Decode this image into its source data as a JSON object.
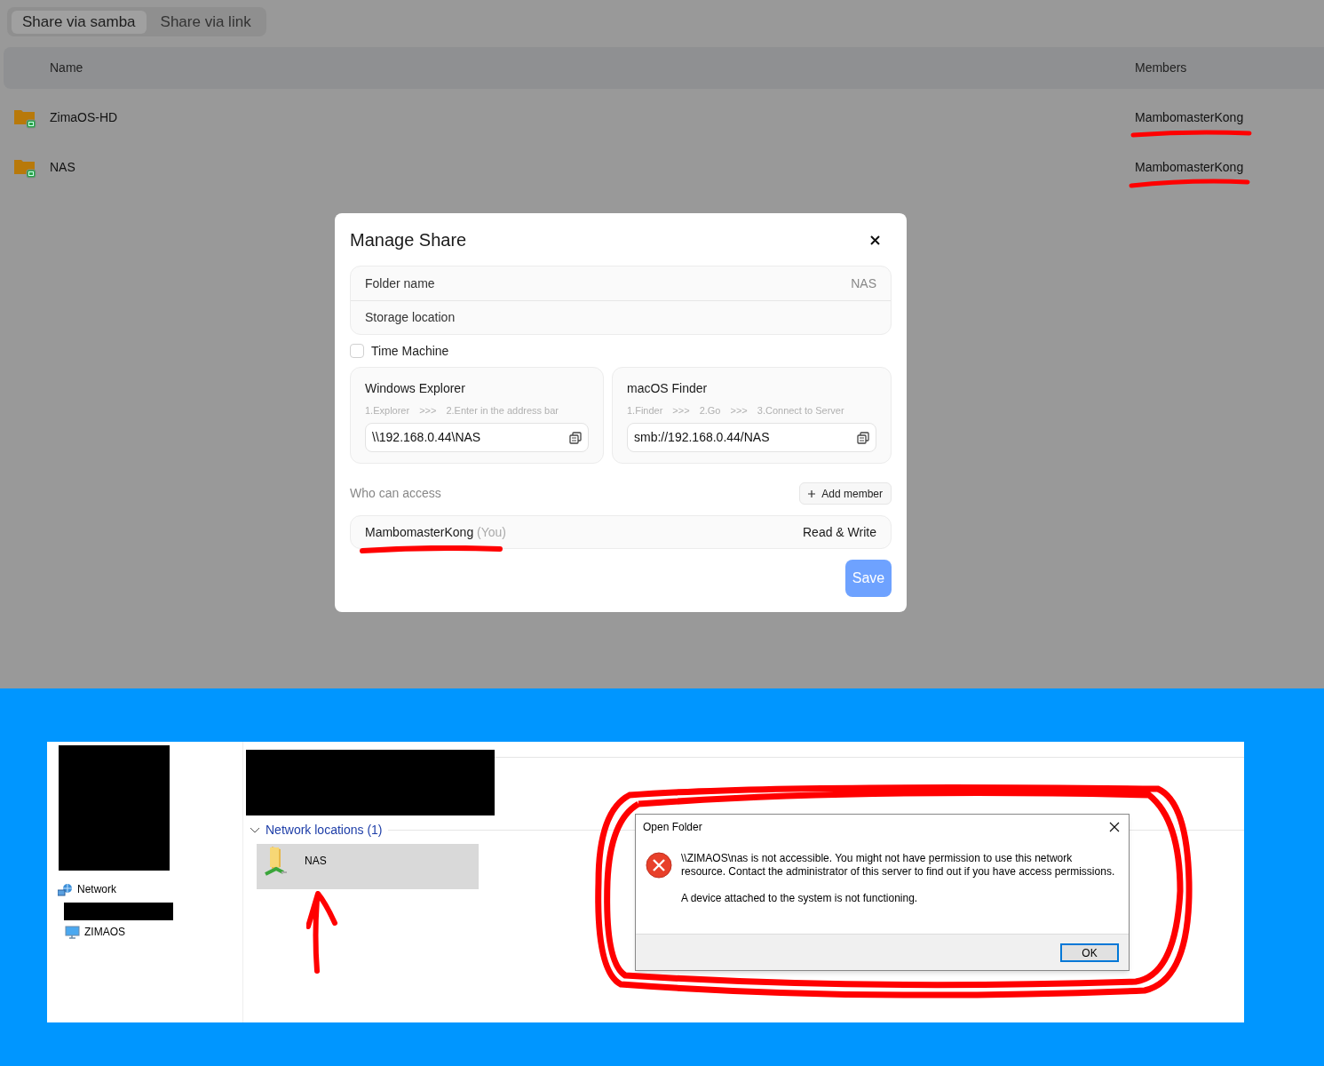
{
  "tabs": [
    {
      "label": "Share via samba",
      "selected": true
    },
    {
      "label": "Share via link",
      "selected": false
    }
  ],
  "table": {
    "columns": [
      "Name",
      "Members"
    ],
    "rows": [
      {
        "name": "ZimaOS-HD",
        "members": "MambomasterKong"
      },
      {
        "name": "NAS",
        "members": "MambomasterKong"
      }
    ]
  },
  "modal": {
    "title": "Manage Share",
    "fields": [
      {
        "label": "Folder name",
        "value": "NAS"
      },
      {
        "label": "Storage location"
      }
    ],
    "time_machine": {
      "label": "Time Machine",
      "checked": false
    },
    "cards": [
      {
        "title": "Windows Explorer",
        "steps": [
          "1.Explorer",
          ">>>",
          "2.Enter in the address bar"
        ],
        "path": "\\\\192.168.0.44\\NAS"
      },
      {
        "title": "macOS Finder",
        "steps": [
          "1.Finder",
          ">>>",
          "2.Go",
          ">>>",
          "3.Connect to Server"
        ],
        "path": "smb://192.168.0.44/NAS"
      }
    ],
    "access_label": "Who can access",
    "add_member": "Add member",
    "members": [
      {
        "name": "MambomasterKong",
        "tag": "(You)",
        "permission": "Read & Write"
      }
    ],
    "save": "Save"
  },
  "explorer": {
    "sidebar": [
      {
        "label": "Network",
        "kind": "network"
      },
      {
        "label": "ZIMAOS",
        "kind": "computer"
      }
    ],
    "section": {
      "title": "Network locations (1)",
      "expanded": true
    },
    "items": [
      {
        "name": "NAS",
        "selected": true
      }
    ]
  },
  "dialog": {
    "title": "Open Folder",
    "messages": [
      "\\\\ZIMAOS\\nas is not accessible. You might not have permission to use this network resource. Contact the administrator of this server to find out if you have access permissions.",
      "A device attached to the system is not functioning."
    ],
    "ok": "OK"
  }
}
